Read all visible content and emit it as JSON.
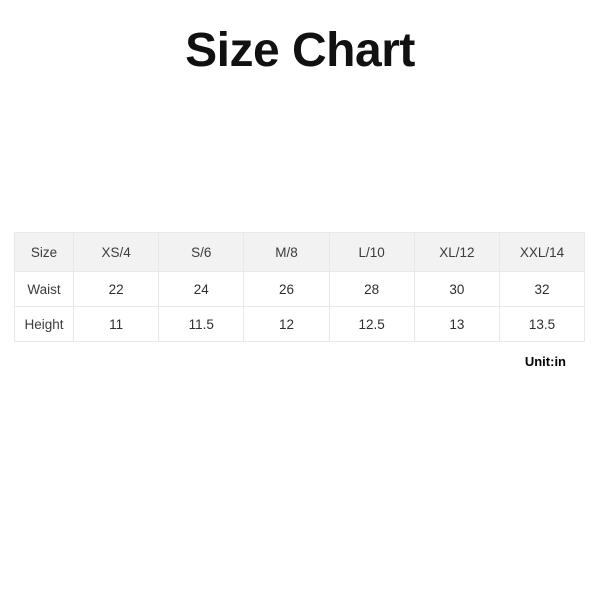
{
  "page": {
    "title": "Size Chart",
    "background_color": "#ffffff",
    "unit_note": "Unit:in"
  },
  "chart_data": {
    "type": "table",
    "title": "Size Chart",
    "columns": [
      "Size",
      "XS/4",
      "S/6",
      "M/8",
      "L/10",
      "XL/12",
      "XXL/14"
    ],
    "rows": [
      {
        "label": "Waist",
        "values": [
          "22",
          "24",
          "26",
          "28",
          "30",
          "32"
        ]
      },
      {
        "label": "Height",
        "values": [
          "11",
          "11.5",
          "12",
          "12.5",
          "13",
          "13.5"
        ]
      }
    ],
    "unit": "in",
    "header_background": "#f2f2f2",
    "border_color": "#e8e8e8",
    "text_color": "#2e2e2e"
  }
}
